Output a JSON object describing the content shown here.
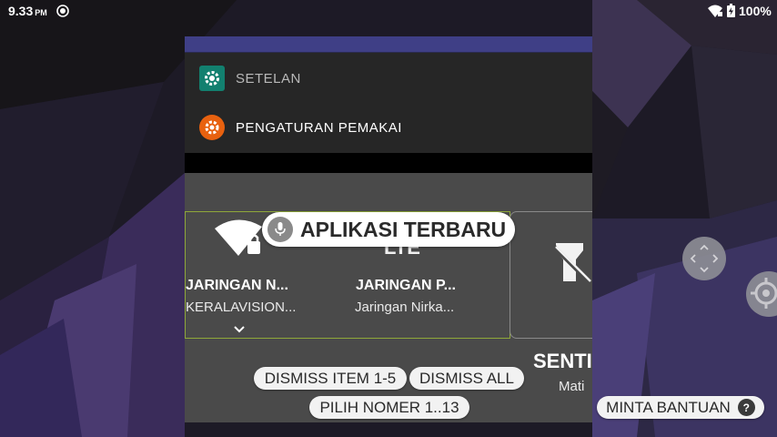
{
  "status_bar": {
    "time": "9.33",
    "ampm": "PM",
    "battery": "100%"
  },
  "recents": {
    "cards": [
      {
        "title": "SETELAN",
        "icon": "settings-gear-icon",
        "icon_color": "#12806f"
      },
      {
        "title": "PENGATURAN PEMAKAI",
        "icon": "user-settings-gear-icon",
        "icon_color": "#e8610f"
      }
    ],
    "quick_settings": {
      "tiles": [
        {
          "label": "JARINGAN N...",
          "sub": "KERALAVISION...",
          "icon": "wifi-lock-icon"
        },
        {
          "label": "JARINGAN P...",
          "sub": "Jaringan Nirka...",
          "icon": "lte-icon"
        },
        {
          "label": "SENTI",
          "sub": "Mati",
          "icon": "flashlight-off-icon"
        }
      ]
    }
  },
  "voice_overlay": {
    "title": "APLIKASI TERBARU",
    "dismiss_items": "DISMISS ITEM 1-5",
    "dismiss_all": "DISMISS ALL",
    "pick_number": "PILIH NOMER 1..13",
    "help": "MINTA BANTUAN",
    "help_icon_text": "?"
  },
  "colors": {
    "accent_indigo": "#3f3f86",
    "wifi_tile_border": "#8fa83a"
  }
}
